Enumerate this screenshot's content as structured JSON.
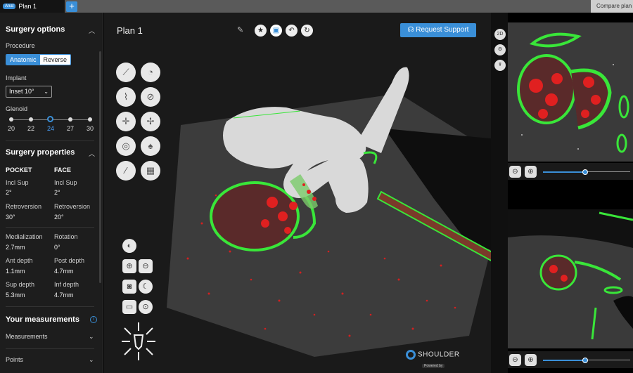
{
  "tabs": {
    "active_chip": "Anat",
    "active_title": "Plan 1",
    "add": "+",
    "right_tab": "Compare plan"
  },
  "left": {
    "surgery_options": "Surgery options",
    "procedure_label": "Procedure",
    "procedure_options": [
      "Anatomic",
      "Reverse"
    ],
    "procedure_selected": "Anatomic",
    "implant_label": "Implant",
    "implant_value": "Inset 10°",
    "glenoid_label": "Glenoid",
    "glenoid_values": [
      "20",
      "22",
      "24",
      "27",
      "30"
    ],
    "glenoid_selected": "24",
    "surgery_properties": "Surgery properties",
    "pocket": "POCKET",
    "face": "FACE",
    "props": {
      "incl_sup_k": "Incl Sup",
      "pocket_incl": "2°",
      "face_incl": "2°",
      "retro_k": "Retroversion",
      "pocket_retro": "30°",
      "face_retro": "20°",
      "medial_k": "Medialization",
      "medial_v": "2.7mm",
      "rotation_k": "Rotation",
      "rotation_v": "0°",
      "ant_k": "Ant depth",
      "ant_v": "1.1mm",
      "post_k": "Post depth",
      "post_v": "4.7mm",
      "sup_k": "Sup depth",
      "sup_v": "5.3mm",
      "inf_k": "Inf depth",
      "inf_v": "4.7mm"
    },
    "your_measurements": "Your measurements",
    "measurements": "Measurements",
    "points": "Points"
  },
  "main": {
    "plan_title": "Plan 1",
    "request_support": "Request Support",
    "logo_text": "SHOULDER",
    "logo_sub": "Powered by",
    "top_icons": [
      "star-icon",
      "cube-icon",
      "undo-icon",
      "redo-icon"
    ]
  },
  "right": {
    "mode_2d": "2D"
  },
  "colors": {
    "accent": "#3a8fd8",
    "segmentation_green": "#39e639",
    "density_red": "#e02020",
    "bone": "#d9d9d9"
  }
}
